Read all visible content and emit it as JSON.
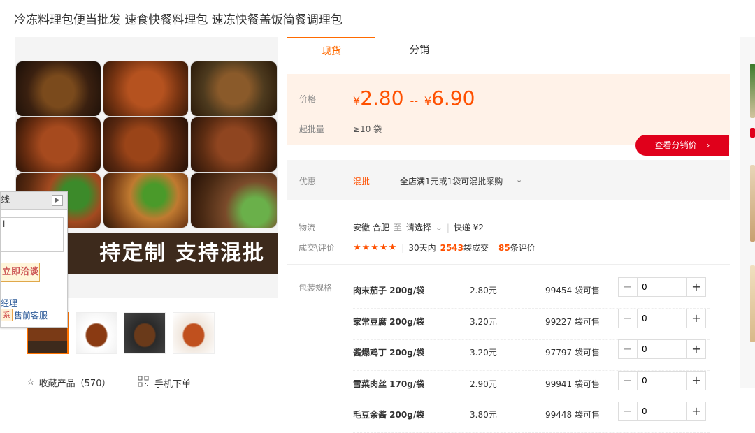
{
  "title": "冷冻料理包便当批发 速食快餐料理包 速冻快餐盖饭简餐调理包",
  "gallery": {
    "banner": "持定制  支持混批",
    "favorite": "收藏产品（570）",
    "mobile_order": "手机下单"
  },
  "chat": {
    "header": "线",
    "input_text": "l",
    "button": "立即洽谈",
    "line1": "经理",
    "tag": "系",
    "line2": "售前客服"
  },
  "tabs": [
    "现货",
    "分销"
  ],
  "price": {
    "label": "价格",
    "low": "2.80",
    "high": "6.90",
    "yen": "¥",
    "dash": "--",
    "moq_label": "起批量",
    "moq": "≥10 袋",
    "dist_button": "查看分销价",
    "dist_arrow": "›"
  },
  "promo": {
    "label": "优惠",
    "tag": "混批",
    "text": "全店满1元或1袋可混批采购",
    "chevron": "⌄"
  },
  "logistics": {
    "label": "物流",
    "from": "安徽 合肥",
    "to": "至",
    "select": "请选择",
    "chevron": "⌄",
    "express": "快递 ¥2"
  },
  "deals": {
    "label": "成交\\评价",
    "stars": "★★★★★",
    "days_text": "30天内",
    "count": "2543",
    "count_unit": "袋成交",
    "reviews": "85",
    "reviews_unit": "条评价"
  },
  "spec": {
    "label": "包装规格",
    "items": [
      {
        "name": "肉末茄子 200g/袋",
        "price": "2.80元",
        "stock": "99454 袋可售",
        "qty": "0"
      },
      {
        "name": "家常豆腐 200g/袋",
        "price": "3.20元",
        "stock": "99227 袋可售",
        "qty": "0"
      },
      {
        "name": "酱爆鸡丁 200g/袋",
        "price": "3.20元",
        "stock": "97797 袋可售",
        "qty": "0"
      },
      {
        "name": "雪菜肉丝 170g/袋",
        "price": "2.90元",
        "stock": "99941 袋可售",
        "qty": "0"
      },
      {
        "name": "毛豆余酱 200g/袋",
        "price": "3.80元",
        "stock": "99448 袋可售",
        "qty": "0"
      }
    ]
  },
  "colors": {
    "accent": "#ff5000",
    "tab_accent": "#ff6a00",
    "dist_red": "#e0001b",
    "price_bg": "#fff2e8"
  }
}
